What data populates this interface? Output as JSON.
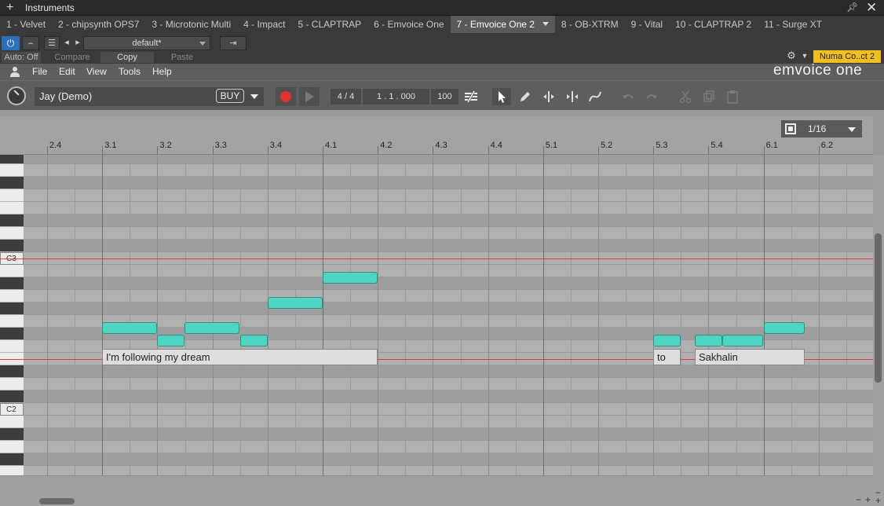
{
  "window": {
    "title": "Instruments"
  },
  "tabs": [
    {
      "label": "1 - Velvet"
    },
    {
      "label": "2 - chipsynth OPS7"
    },
    {
      "label": "3 - Microtonic Multi"
    },
    {
      "label": "4 - Impact"
    },
    {
      "label": "5 - CLAPTRAP"
    },
    {
      "label": "6 - Emvoice One"
    },
    {
      "label": "7 - Emvoice One 2",
      "active": true
    },
    {
      "label": "8 - OB-XTRM"
    },
    {
      "label": "9 - Vital"
    },
    {
      "label": "10 - CLAPTRAP 2"
    },
    {
      "label": "11 - Surge XT"
    }
  ],
  "host": {
    "preset": "default*",
    "auto": "Auto: Off",
    "compare": "Compare",
    "copy": "Copy",
    "paste": "Paste",
    "device": "Numa Co..ct 2"
  },
  "plugin": {
    "menu": [
      "File",
      "Edit",
      "View",
      "Tools",
      "Help"
    ],
    "logo": "emvoice one",
    "voice": "Jay (Demo)",
    "buy": "BUY",
    "time_sig": "4 / 4",
    "position": "1 . 1 . 000",
    "tempo": "100"
  },
  "editor": {
    "quantize": "1/16",
    "ruler": [
      "2.4",
      "3.1",
      "3.2",
      "3.3",
      "3.4",
      "4.1",
      "4.2",
      "4.3",
      "4.4",
      "5.1",
      "5.2",
      "5.3",
      "5.4",
      "6.1",
      "6.2"
    ],
    "key_labels": {
      "c3": "C3",
      "c2": "C2"
    },
    "lyrics": [
      {
        "text": "I'm following my dream"
      },
      {
        "text": "to"
      },
      {
        "text": "Sakhalin"
      }
    ]
  },
  "colors": {
    "accent": "#2d6fb8",
    "note": "#4fd5c2",
    "record": "#e03030",
    "device_badge": "#f0c020"
  }
}
